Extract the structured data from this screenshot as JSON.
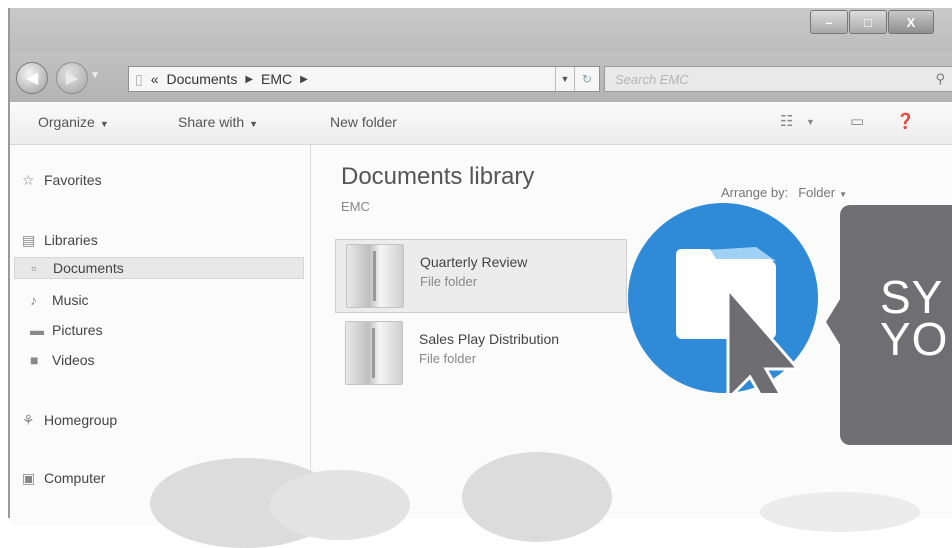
{
  "window": {
    "controls": {
      "minimize": "–",
      "maximize": "□",
      "close": "X"
    }
  },
  "address": {
    "overflow": "«",
    "crumbs": [
      "Documents",
      "EMC"
    ],
    "search_placeholder": "Search EMC"
  },
  "toolbar": {
    "organize": "Organize",
    "share_with": "Share with",
    "new_folder": "New folder"
  },
  "nav": {
    "favorites": "Favorites",
    "libraries": "Libraries",
    "documents": "Documents",
    "music": "Music",
    "pictures": "Pictures",
    "videos": "Videos",
    "homegroup": "Homegroup",
    "computer": "Computer"
  },
  "content": {
    "title": "Documents library",
    "subtitle": "EMC",
    "arrange_label": "Arrange by:",
    "arrange_value": "Folder",
    "files": [
      {
        "name": "Quarterly Review",
        "type": "File folder"
      },
      {
        "name": "Sales Play Distribution",
        "type": "File folder"
      }
    ]
  },
  "overlay": {
    "callout_text": "SY\nYO",
    "badge_color": "#2f8ad8",
    "callout_color": "#6f6e73"
  },
  "icons": [
    "back-icon",
    "forward-icon",
    "folder-icon",
    "refresh-icon",
    "search-icon",
    "views-icon",
    "preview-pane-icon",
    "help-icon",
    "star-icon",
    "library-icon",
    "document-icon",
    "music-icon",
    "pictures-icon",
    "videos-icon",
    "homegroup-icon",
    "computer-icon",
    "cursor-icon"
  ]
}
